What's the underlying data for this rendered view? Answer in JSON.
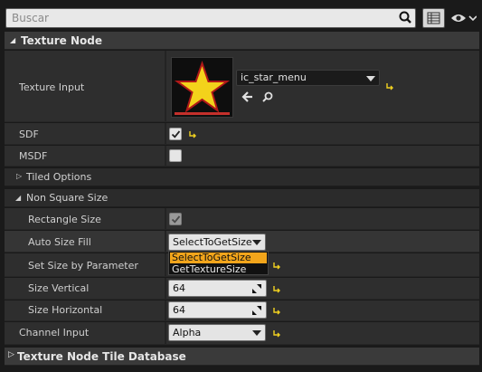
{
  "search": {
    "placeholder": "Buscar"
  },
  "colors": {
    "accent": "#f2a51b",
    "reset_arrow": "#f0d020",
    "texture_bar": "#c4302b"
  },
  "categories": {
    "texture_node": "Texture Node",
    "tiled_options": "Tiled Options",
    "non_square_size": "Non Square Size",
    "tile_database": "Texture Node Tile Database"
  },
  "properties": {
    "texture_input": {
      "label": "Texture Input",
      "asset_name": "ic_star_menu"
    },
    "sdf": {
      "label": "SDF",
      "checked": true
    },
    "msdf": {
      "label": "MSDF",
      "checked": false
    },
    "rectangle_size": {
      "label": "Rectangle Size",
      "checked": true
    },
    "auto_size_fill": {
      "label": "Auto Size Fill",
      "value": "SelectToGetSize",
      "options": [
        "SelectToGetSize",
        "GetTextureSize"
      ]
    },
    "set_size_by_parameter": {
      "label": "Set Size by Parameter"
    },
    "size_vertical": {
      "label": "Size Vertical",
      "value": "64"
    },
    "size_horizontal": {
      "label": "Size Horizontal",
      "value": "64"
    },
    "channel_input": {
      "label": "Channel Input",
      "value": "Alpha"
    }
  }
}
